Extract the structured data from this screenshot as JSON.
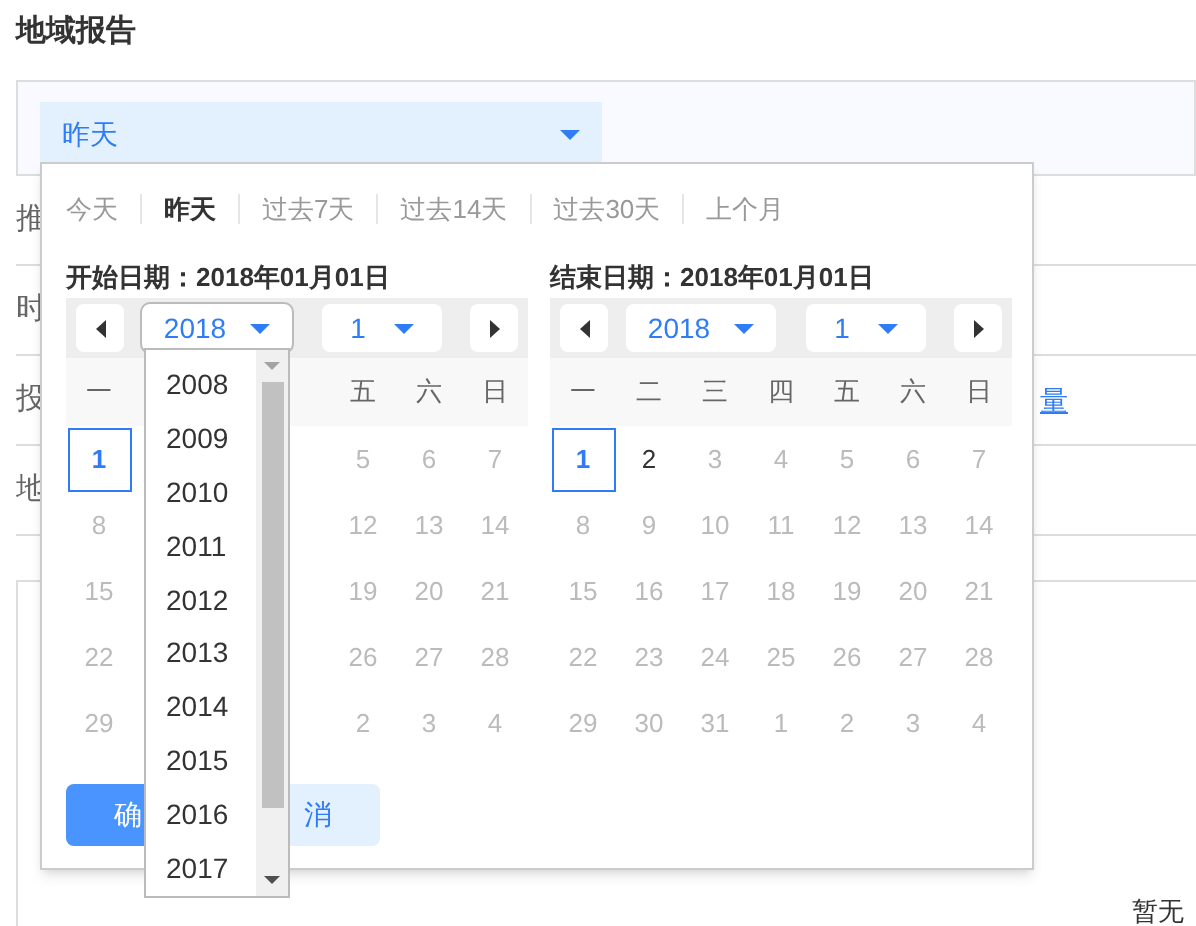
{
  "page_title": "地域报告",
  "range_select": {
    "value": "昨天"
  },
  "form_rows": [
    {
      "label": "推"
    },
    {
      "label": "时"
    },
    {
      "label": "投",
      "link": "量"
    },
    {
      "label": "地"
    }
  ],
  "date_picker": {
    "quick_ranges": [
      {
        "label": "今天",
        "selected": false
      },
      {
        "label": "昨天",
        "selected": true
      },
      {
        "label": "过去7天",
        "selected": false
      },
      {
        "label": "过去14天",
        "selected": false
      },
      {
        "label": "过去30天",
        "selected": false
      },
      {
        "label": "上个月",
        "selected": false
      }
    ],
    "calendars": [
      {
        "header": "开始日期：2018年01月01日",
        "year": "2018",
        "month": "1",
        "year_expanded": true,
        "year_options": [
          "2008",
          "2009",
          "2010",
          "2011",
          "2012",
          "2013",
          "2014",
          "2015",
          "2016",
          "2017"
        ],
        "weekdays": [
          {
            "kind": "label",
            "text": "一"
          },
          {
            "kind": "covered"
          },
          {
            "kind": "covered"
          },
          {
            "kind": "covered"
          },
          {
            "kind": "label",
            "text": "五"
          },
          {
            "kind": "label",
            "text": "六"
          },
          {
            "kind": "label",
            "text": "日"
          }
        ],
        "weeks": [
          [
            {
              "kind": "day",
              "text": "1",
              "selected": true,
              "disabled": false
            },
            {
              "kind": "covered"
            },
            {
              "kind": "covered"
            },
            {
              "kind": "covered"
            },
            {
              "kind": "day",
              "text": "5",
              "selected": false,
              "disabled": true
            },
            {
              "kind": "day",
              "text": "6",
              "selected": false,
              "disabled": true
            },
            {
              "kind": "day",
              "text": "7",
              "selected": false,
              "disabled": true
            }
          ],
          [
            {
              "kind": "day",
              "text": "8",
              "selected": false,
              "disabled": true
            },
            {
              "kind": "covered"
            },
            {
              "kind": "covered"
            },
            {
              "kind": "covered"
            },
            {
              "kind": "day",
              "text": "12",
              "selected": false,
              "disabled": true
            },
            {
              "kind": "day",
              "text": "13",
              "selected": false,
              "disabled": true
            },
            {
              "kind": "day",
              "text": "14",
              "selected": false,
              "disabled": true
            }
          ],
          [
            {
              "kind": "day",
              "text": "15",
              "selected": false,
              "disabled": true
            },
            {
              "kind": "covered"
            },
            {
              "kind": "covered"
            },
            {
              "kind": "covered"
            },
            {
              "kind": "day",
              "text": "19",
              "selected": false,
              "disabled": true
            },
            {
              "kind": "day",
              "text": "20",
              "selected": false,
              "disabled": true
            },
            {
              "kind": "day",
              "text": "21",
              "selected": false,
              "disabled": true
            }
          ],
          [
            {
              "kind": "day",
              "text": "22",
              "selected": false,
              "disabled": true
            },
            {
              "kind": "covered"
            },
            {
              "kind": "covered"
            },
            {
              "kind": "covered"
            },
            {
              "kind": "day",
              "text": "26",
              "selected": false,
              "disabled": true
            },
            {
              "kind": "day",
              "text": "27",
              "selected": false,
              "disabled": true
            },
            {
              "kind": "day",
              "text": "28",
              "selected": false,
              "disabled": true
            }
          ],
          [
            {
              "kind": "day",
              "text": "29",
              "selected": false,
              "disabled": true
            },
            {
              "kind": "covered"
            },
            {
              "kind": "covered"
            },
            {
              "kind": "covered"
            },
            {
              "kind": "day",
              "text": "2",
              "selected": false,
              "disabled": true
            },
            {
              "kind": "day",
              "text": "3",
              "selected": false,
              "disabled": true
            },
            {
              "kind": "day",
              "text": "4",
              "selected": false,
              "disabled": true
            }
          ]
        ]
      },
      {
        "header": "结束日期：2018年01月01日",
        "year": "2018",
        "month": "1",
        "year_expanded": false,
        "weekdays": [
          {
            "kind": "label",
            "text": "一"
          },
          {
            "kind": "label",
            "text": "二"
          },
          {
            "kind": "label",
            "text": "三"
          },
          {
            "kind": "label",
            "text": "四"
          },
          {
            "kind": "label",
            "text": "五"
          },
          {
            "kind": "label",
            "text": "六"
          },
          {
            "kind": "label",
            "text": "日"
          }
        ],
        "weeks": [
          [
            {
              "kind": "day",
              "text": "1",
              "selected": true,
              "disabled": false
            },
            {
              "kind": "day",
              "text": "2",
              "selected": false,
              "disabled": false
            },
            {
              "kind": "day",
              "text": "3",
              "selected": false,
              "disabled": true
            },
            {
              "kind": "day",
              "text": "4",
              "selected": false,
              "disabled": true
            },
            {
              "kind": "day",
              "text": "5",
              "selected": false,
              "disabled": true
            },
            {
              "kind": "day",
              "text": "6",
              "selected": false,
              "disabled": true
            },
            {
              "kind": "day",
              "text": "7",
              "selected": false,
              "disabled": true
            }
          ],
          [
            {
              "kind": "day",
              "text": "8",
              "selected": false,
              "disabled": true
            },
            {
              "kind": "day",
              "text": "9",
              "selected": false,
              "disabled": true
            },
            {
              "kind": "day",
              "text": "10",
              "selected": false,
              "disabled": true
            },
            {
              "kind": "day",
              "text": "11",
              "selected": false,
              "disabled": true
            },
            {
              "kind": "day",
              "text": "12",
              "selected": false,
              "disabled": true
            },
            {
              "kind": "day",
              "text": "13",
              "selected": false,
              "disabled": true
            },
            {
              "kind": "day",
              "text": "14",
              "selected": false,
              "disabled": true
            }
          ],
          [
            {
              "kind": "day",
              "text": "15",
              "selected": false,
              "disabled": true
            },
            {
              "kind": "day",
              "text": "16",
              "selected": false,
              "disabled": true
            },
            {
              "kind": "day",
              "text": "17",
              "selected": false,
              "disabled": true
            },
            {
              "kind": "day",
              "text": "18",
              "selected": false,
              "disabled": true
            },
            {
              "kind": "day",
              "text": "19",
              "selected": false,
              "disabled": true
            },
            {
              "kind": "day",
              "text": "20",
              "selected": false,
              "disabled": true
            },
            {
              "kind": "day",
              "text": "21",
              "selected": false,
              "disabled": true
            }
          ],
          [
            {
              "kind": "day",
              "text": "22",
              "selected": false,
              "disabled": true
            },
            {
              "kind": "day",
              "text": "23",
              "selected": false,
              "disabled": true
            },
            {
              "kind": "day",
              "text": "24",
              "selected": false,
              "disabled": true
            },
            {
              "kind": "day",
              "text": "25",
              "selected": false,
              "disabled": true
            },
            {
              "kind": "day",
              "text": "26",
              "selected": false,
              "disabled": true
            },
            {
              "kind": "day",
              "text": "27",
              "selected": false,
              "disabled": true
            },
            {
              "kind": "day",
              "text": "28",
              "selected": false,
              "disabled": true
            }
          ],
          [
            {
              "kind": "day",
              "text": "29",
              "selected": false,
              "disabled": true
            },
            {
              "kind": "day",
              "text": "30",
              "selected": false,
              "disabled": true
            },
            {
              "kind": "day",
              "text": "31",
              "selected": false,
              "disabled": true
            },
            {
              "kind": "day",
              "text": "1",
              "selected": false,
              "disabled": true
            },
            {
              "kind": "day",
              "text": "2",
              "selected": false,
              "disabled": true
            },
            {
              "kind": "day",
              "text": "3",
              "selected": false,
              "disabled": true
            },
            {
              "kind": "day",
              "text": "4",
              "selected": false,
              "disabled": true
            }
          ]
        ]
      }
    ],
    "buttons": [
      {
        "label": "确",
        "kind": "primary"
      },
      {
        "label": "消",
        "kind": "secondary"
      }
    ]
  },
  "empty_text": "暂无"
}
